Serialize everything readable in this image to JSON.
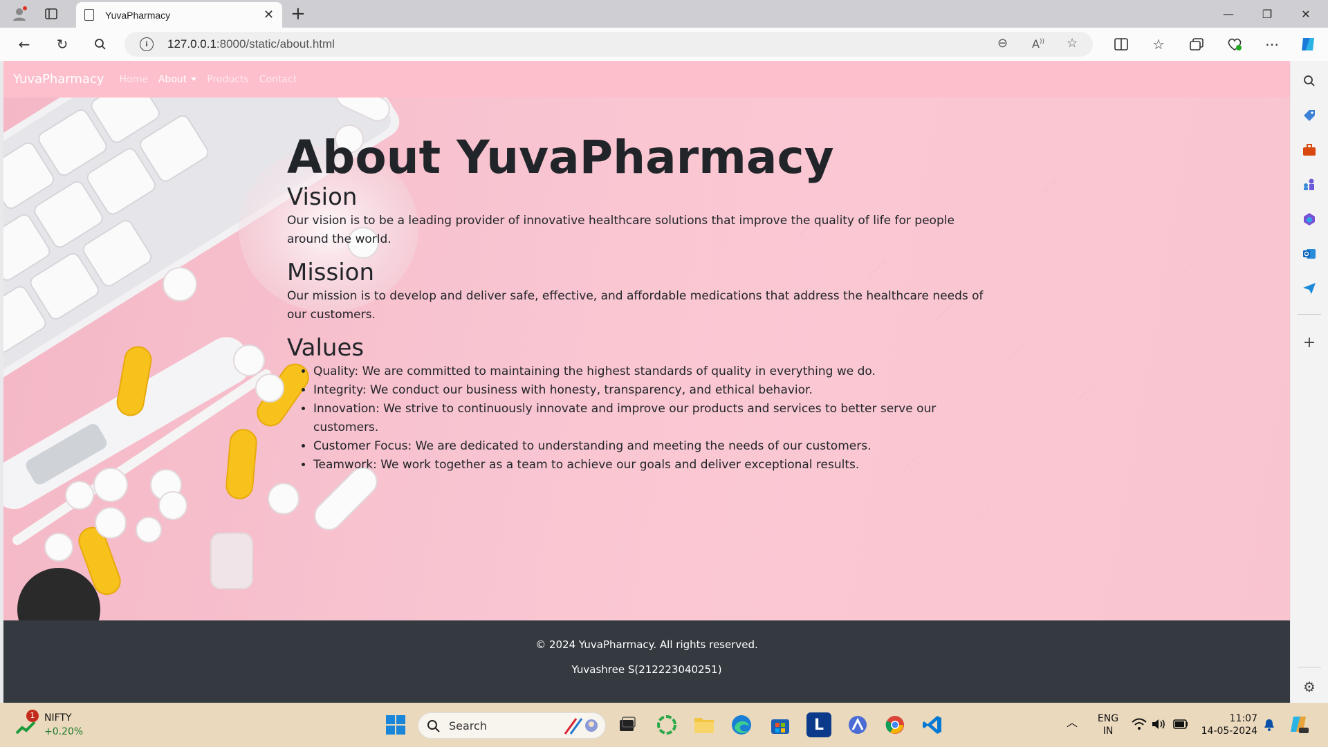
{
  "browser": {
    "tab_title": "YuvaPharmacy",
    "url_host": "127.0.0.1",
    "url_rest": ":8000/static/about.html"
  },
  "site": {
    "brand": "YuvaPharmacy",
    "nav": [
      "Home",
      "About",
      "Products",
      "Contact"
    ],
    "active_nav": "About"
  },
  "page": {
    "title": "About YuvaPharmacy",
    "vision_heading": "Vision",
    "vision_text": "Our vision is to be a leading provider of innovative healthcare solutions that improve the quality of life for people around the world.",
    "mission_heading": "Mission",
    "mission_text": "Our mission is to develop and deliver safe, effective, and affordable medications that address the healthcare needs of our customers.",
    "values_heading": "Values",
    "values": [
      "Quality: We are committed to maintaining the highest standards of quality in everything we do.",
      "Integrity: We conduct our business with honesty, transparency, and ethical behavior.",
      "Innovation: We strive to continuously innovate and improve our products and services to better serve our customers.",
      "Customer Focus: We are dedicated to understanding and meeting the needs of our customers.",
      "Teamwork: We work together as a team to achieve our goals and deliver exceptional results."
    ]
  },
  "footer": {
    "copyright": "© 2024 YuvaPharmacy. All rights reserved.",
    "author": "Yuvashree S(212223040251)"
  },
  "taskbar": {
    "stock_name": "NIFTY",
    "stock_change": "+0.20%",
    "stock_badge": "1",
    "search_placeholder": "Search",
    "lang_top": "ENG",
    "lang_bottom": "IN",
    "time": "11:07",
    "date": "14-05-2024"
  },
  "colors": {
    "navbar": "#fdbfcc",
    "footer": "#343a40",
    "page_bg": "#f9c6d1"
  }
}
